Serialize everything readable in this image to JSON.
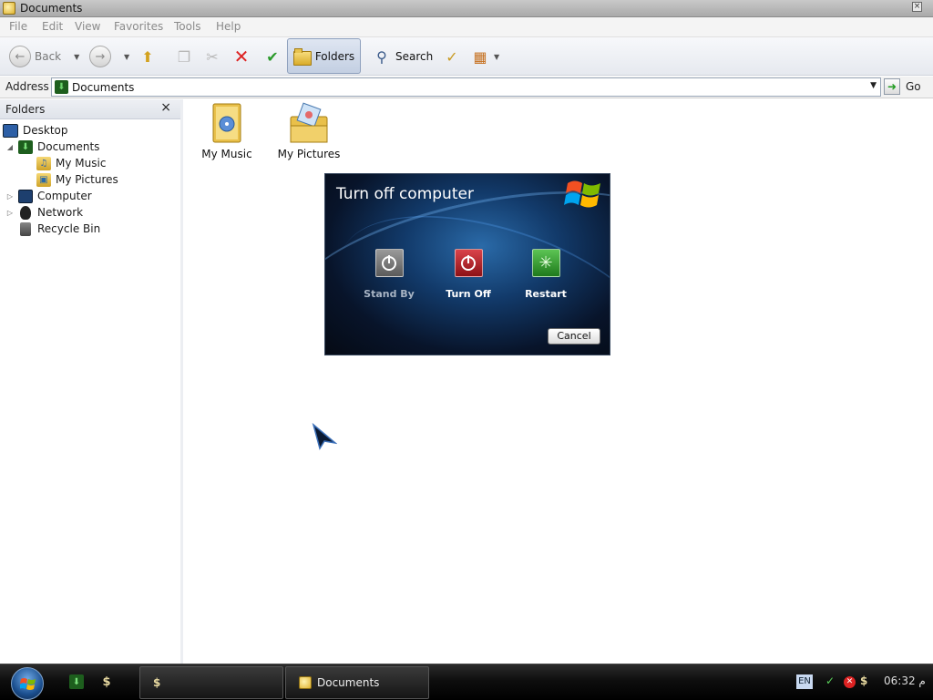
{
  "window": {
    "title": "Documents"
  },
  "menu": [
    "File",
    "Edit",
    "View",
    "Favorites",
    "Tools",
    "Help"
  ],
  "toolbar": {
    "back_label": "Back",
    "folders_label": "Folders",
    "search_label": "Search"
  },
  "address": {
    "label": "Address",
    "value": "Documents",
    "go_label": "Go"
  },
  "folders_pane": {
    "title": "Folders",
    "items": [
      {
        "label": "Desktop",
        "icon": "desktop-icon"
      },
      {
        "label": "Documents",
        "icon": "documents-icon"
      },
      {
        "label": "My Music",
        "icon": "music-folder-icon"
      },
      {
        "label": "My Pictures",
        "icon": "pictures-folder-icon"
      },
      {
        "label": "Computer",
        "icon": "computer-icon"
      },
      {
        "label": "Network",
        "icon": "network-icon"
      },
      {
        "label": "Recycle Bin",
        "icon": "recycle-bin-icon"
      }
    ]
  },
  "content": {
    "items": [
      {
        "label": "My Music",
        "icon": "music-folder-icon"
      },
      {
        "label": "My Pictures",
        "icon": "pictures-folder-icon"
      }
    ]
  },
  "dialog": {
    "title": "Turn off computer",
    "buttons": [
      {
        "label": "Stand By",
        "color": "#7a7a7a"
      },
      {
        "label": "Turn Off",
        "color": "#b01c24"
      },
      {
        "label": "Restart",
        "color": "#2f9a2a"
      }
    ],
    "cancel_label": "Cancel"
  },
  "taskbar": {
    "tasks": [
      {
        "label": ""
      },
      {
        "label": "Documents"
      }
    ],
    "language": "EN",
    "clock": "06:32 م"
  }
}
